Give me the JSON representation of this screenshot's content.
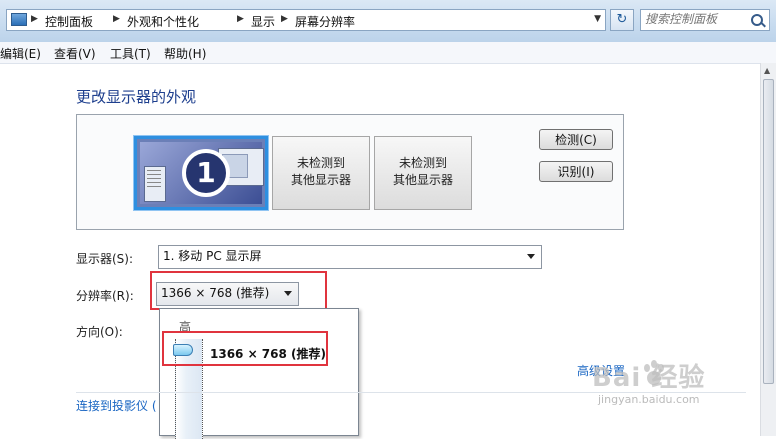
{
  "address_bar": {
    "crumbs": [
      "控制面板",
      "外观和个性化",
      "显示",
      "屏幕分辨率"
    ],
    "search_placeholder": "搜索控制面板"
  },
  "menu": [
    "编辑(E)",
    "查看(V)",
    "工具(T)",
    "帮助(H)"
  ],
  "main": {
    "title": "更改显示器的外观",
    "monitors": [
      {
        "label": "1"
      },
      {
        "line1": "未检测到",
        "line2": "其他显示器"
      },
      {
        "line1": "未检测到",
        "line2": "其他显示器"
      }
    ],
    "detect_label": "检测(C)",
    "identify_label": "识别(I)",
    "display_label": "显示器(S):",
    "display_value": "1. 移动 PC 显示屏",
    "resolution_label": "分辨率(R):",
    "resolution_value": "1366 × 768 (推荐)",
    "orientation_label": "方向(O):",
    "advanced_link": "高级设置",
    "projector_link": "连接到投影仪 (",
    "popup": {
      "high_label": "高",
      "option": "1366 × 768 (推荐)",
      "slider_level": 1.0
    }
  },
  "watermark": {
    "text": "Bai  经验",
    "sub": "jingyan.baidu.com"
  },
  "colors": {
    "accent": "#2e8fe0",
    "highlight_red": "#e0343e",
    "title_blue": "#1e3f8e",
    "link": "#1764c2"
  }
}
